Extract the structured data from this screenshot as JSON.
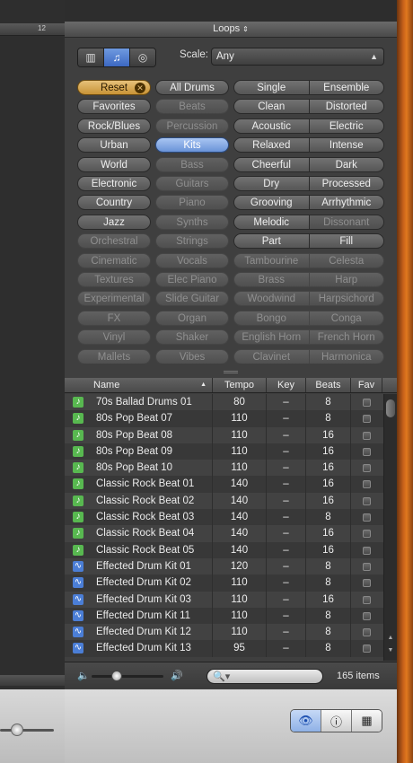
{
  "ruler_number": "12",
  "panel_title": "Loops",
  "scale": {
    "label": "Scale:",
    "value": "Any"
  },
  "view_buttons": [
    {
      "icon": "column-view-icon",
      "glyph": "|||"
    },
    {
      "icon": "music-note-icon",
      "glyph": "♫"
    },
    {
      "icon": "podcast-icon",
      "glyph": "◎"
    }
  ],
  "keywords": {
    "col1": [
      "Reset",
      "Favorites",
      "Rock/Blues",
      "Urban",
      "World",
      "Electronic",
      "Country",
      "Jazz",
      "Orchestral",
      "Cinematic",
      "Textures",
      "Experimental",
      "FX",
      "Vinyl",
      "Mallets"
    ],
    "col2": [
      "All Drums",
      "Beats",
      "Percussion",
      "Kits",
      "Bass",
      "Guitars",
      "Piano",
      "Synths",
      "Strings",
      "Vocals",
      "Elec Piano",
      "Slide Guitar",
      "Organ",
      "Shaker",
      "Vibes"
    ],
    "pairs": [
      [
        "Single",
        "Ensemble"
      ],
      [
        "Clean",
        "Distorted"
      ],
      [
        "Acoustic",
        "Electric"
      ],
      [
        "Relaxed",
        "Intense"
      ],
      [
        "Cheerful",
        "Dark"
      ],
      [
        "Dry",
        "Processed"
      ],
      [
        "Grooving",
        "Arrhythmic"
      ],
      [
        "Melodic",
        "Dissonant"
      ],
      [
        "Part",
        "Fill"
      ],
      [
        "Tambourine",
        "Celesta"
      ],
      [
        "Brass",
        "Harp"
      ],
      [
        "Woodwind",
        "Harpsichord"
      ],
      [
        "Bongo",
        "Conga"
      ],
      [
        "English Horn",
        "French Horn"
      ],
      [
        "Clavinet",
        "Harmonica"
      ]
    ]
  },
  "table": {
    "headers": {
      "name": "Name",
      "tempo": "Tempo",
      "key": "Key",
      "beats": "Beats",
      "fav": "Fav"
    },
    "rows": [
      {
        "type": "music",
        "name": "70s Ballad Drums 01",
        "tempo": "80",
        "key": "–",
        "beats": "8"
      },
      {
        "type": "music",
        "name": "80s Pop Beat 07",
        "tempo": "110",
        "key": "–",
        "beats": "8"
      },
      {
        "type": "music",
        "name": "80s Pop Beat 08",
        "tempo": "110",
        "key": "–",
        "beats": "16"
      },
      {
        "type": "music",
        "name": "80s Pop Beat 09",
        "tempo": "110",
        "key": "–",
        "beats": "16"
      },
      {
        "type": "music",
        "name": "80s Pop Beat 10",
        "tempo": "110",
        "key": "–",
        "beats": "16"
      },
      {
        "type": "music",
        "name": "Classic Rock Beat 01",
        "tempo": "140",
        "key": "–",
        "beats": "16"
      },
      {
        "type": "music",
        "name": "Classic Rock Beat 02",
        "tempo": "140",
        "key": "–",
        "beats": "16"
      },
      {
        "type": "music",
        "name": "Classic Rock Beat 03",
        "tempo": "140",
        "key": "–",
        "beats": "8"
      },
      {
        "type": "music",
        "name": "Classic Rock Beat 04",
        "tempo": "140",
        "key": "–",
        "beats": "16"
      },
      {
        "type": "music",
        "name": "Classic Rock Beat 05",
        "tempo": "140",
        "key": "–",
        "beats": "16"
      },
      {
        "type": "audio",
        "name": "Effected Drum Kit 01",
        "tempo": "120",
        "key": "–",
        "beats": "8"
      },
      {
        "type": "audio",
        "name": "Effected Drum Kit 02",
        "tempo": "110",
        "key": "–",
        "beats": "8"
      },
      {
        "type": "audio",
        "name": "Effected Drum Kit 03",
        "tempo": "110",
        "key": "–",
        "beats": "16"
      },
      {
        "type": "audio",
        "name": "Effected Drum Kit 11",
        "tempo": "110",
        "key": "–",
        "beats": "8"
      },
      {
        "type": "audio",
        "name": "Effected Drum Kit 12",
        "tempo": "110",
        "key": "–",
        "beats": "8"
      },
      {
        "type": "audio",
        "name": "Effected Drum Kit 13",
        "tempo": "95",
        "key": "–",
        "beats": "8"
      }
    ]
  },
  "search": {
    "placeholder": ""
  },
  "items_count": "165 items",
  "colors": {
    "reset": "#d4a048",
    "selected": "#7aa0e0",
    "music_icon": "#58b850",
    "audio_icon": "#4b7ed6",
    "wood": "#c8611a"
  }
}
